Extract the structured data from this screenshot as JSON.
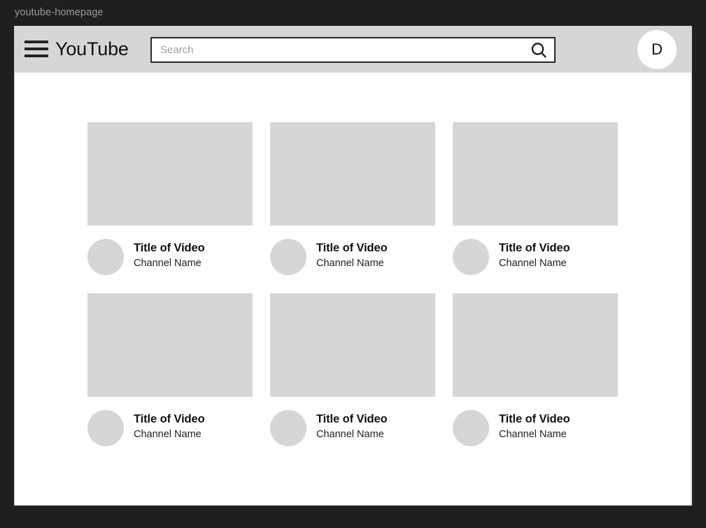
{
  "window": {
    "title": "youtube-homepage"
  },
  "header": {
    "menu_icon": "hamburger-menu-icon",
    "brand": "YouTube",
    "search": {
      "placeholder": "Search",
      "value": "",
      "icon": "search-icon"
    },
    "avatar": {
      "initial": "D"
    }
  },
  "main": {
    "videos": [
      {
        "title": "Title of Video",
        "channel": "Channel Name"
      },
      {
        "title": "Title of Video",
        "channel": "Channel Name"
      },
      {
        "title": "Title of Video",
        "channel": "Channel Name"
      },
      {
        "title": "Title of Video",
        "channel": "Channel Name"
      },
      {
        "title": "Title of Video",
        "channel": "Channel Name"
      },
      {
        "title": "Title of Video",
        "channel": "Channel Name"
      }
    ]
  },
  "colors": {
    "desktop_background": "#1f1f1f",
    "header_background": "#d6d6d6",
    "placeholder_gray": "#d6d6d6",
    "page_background": "#ffffff",
    "text_primary": "#111111",
    "titlebar_text": "#9a9a9a"
  }
}
